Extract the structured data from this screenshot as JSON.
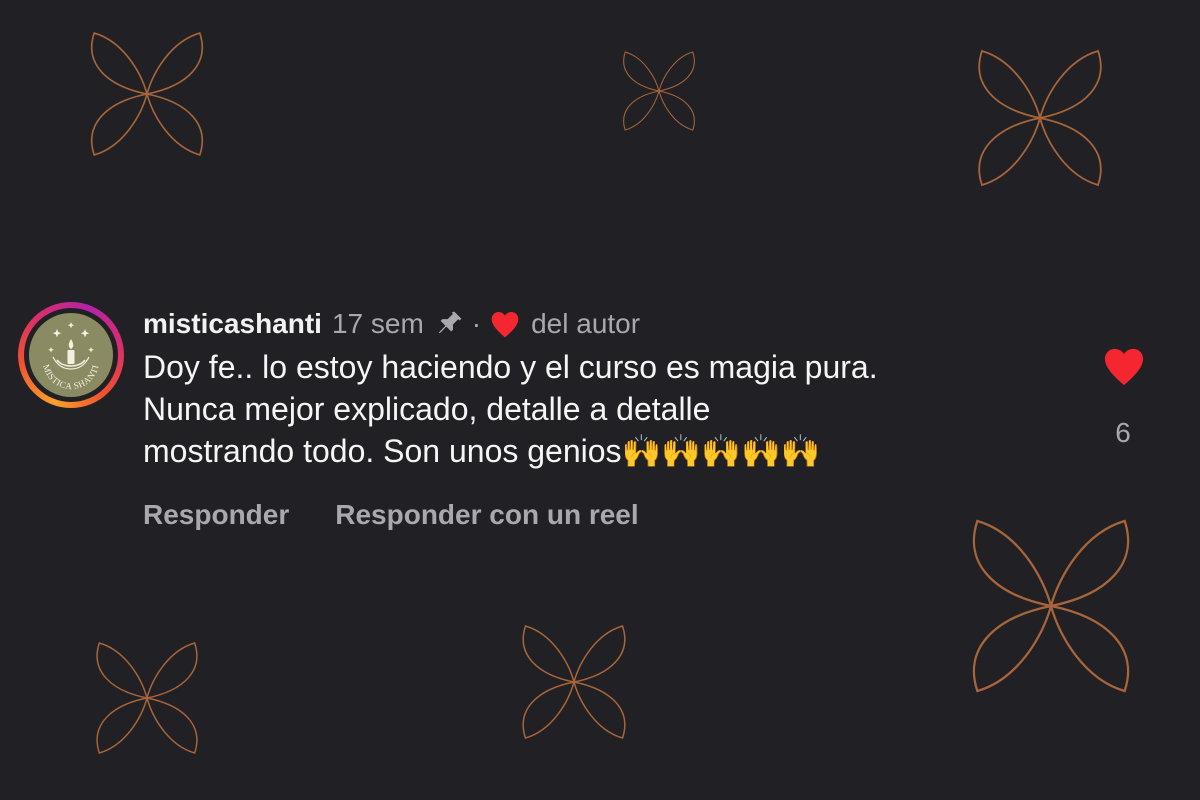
{
  "colors": {
    "background": "#212125",
    "decor_stroke": "#a8653a",
    "like_red": "#f4262f",
    "text_primary": "#f5f5f5",
    "text_secondary": "#a8a8ad"
  },
  "background_decor": {
    "icon": "four-petal-flower-outline"
  },
  "comment": {
    "avatar": {
      "ring": "story-gradient-ring",
      "logo_text": "MISTICA SHANTI",
      "icon": "candle-with-stars"
    },
    "username": "misticashanti",
    "time": "17 sem",
    "pin_icon": "pin-icon",
    "separator": "·",
    "author_heart_icon": "heart-icon",
    "author_like_label": "del autor",
    "text": "Doy fe.. lo estoy haciendo y el curso es magia pura.\nNunca mejor explicado,  detalle a detalle\nmostrando todo. Son unos genios🙌🙌🙌🙌🙌",
    "actions": {
      "reply": "Responder",
      "reply_reel": "Responder con un reel"
    },
    "like": {
      "icon": "heart-icon",
      "liked": true,
      "count": "6"
    }
  }
}
